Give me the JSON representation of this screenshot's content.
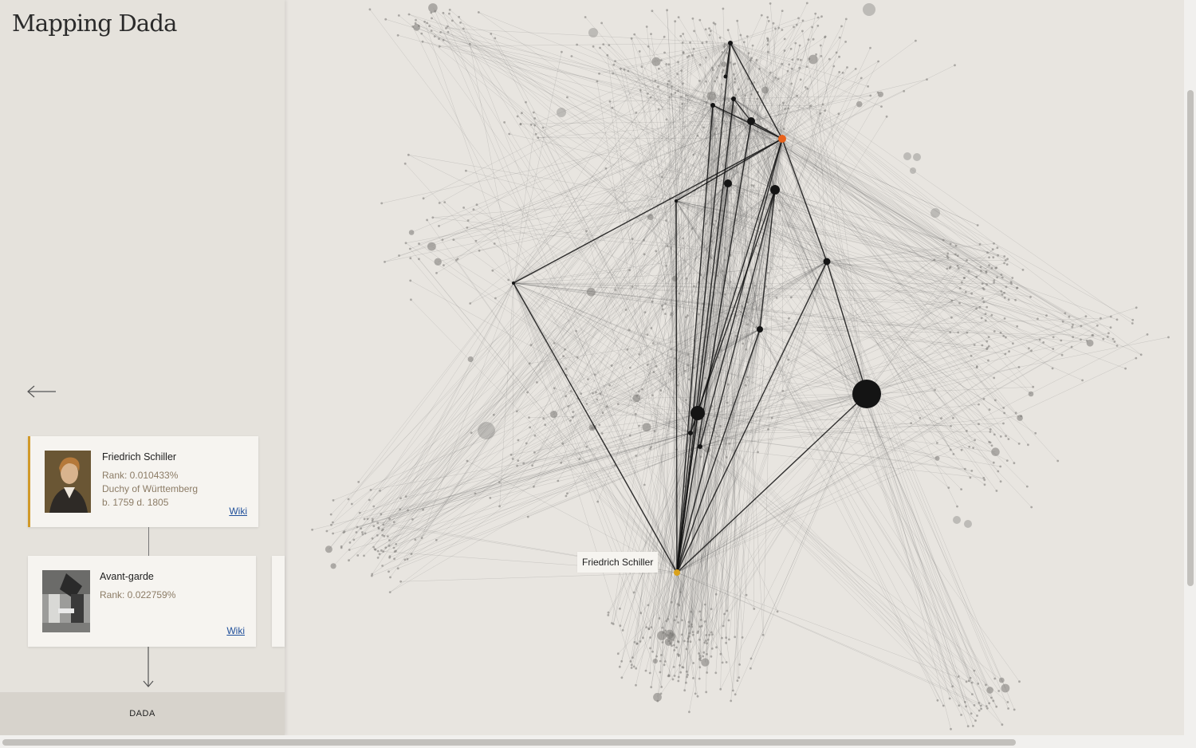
{
  "app": {
    "title": "Mapping Dada"
  },
  "path": [
    {
      "name": "Friedrich Schiller",
      "rank": "Rank: 0.010433%",
      "place": "Duchy of Württemberg",
      "dates": "b. 1759 d. 1805",
      "link": "Wiki",
      "thumbnail": "portrait-painting"
    },
    {
      "name": "Avant-garde",
      "rank": "Rank: 0.022759%",
      "link": "Wiki",
      "thumbnail": "bw-photograph"
    }
  ],
  "footer": {
    "label": "DADA"
  },
  "graph": {
    "hover_label": "Friedrich Schiller",
    "colors": {
      "selected": "#e8621c",
      "origin": "#d9a11b",
      "path": "#111111",
      "edge": "#555555"
    }
  },
  "icons": {
    "back": "arrow-left-icon",
    "down": "arrow-down-icon"
  }
}
